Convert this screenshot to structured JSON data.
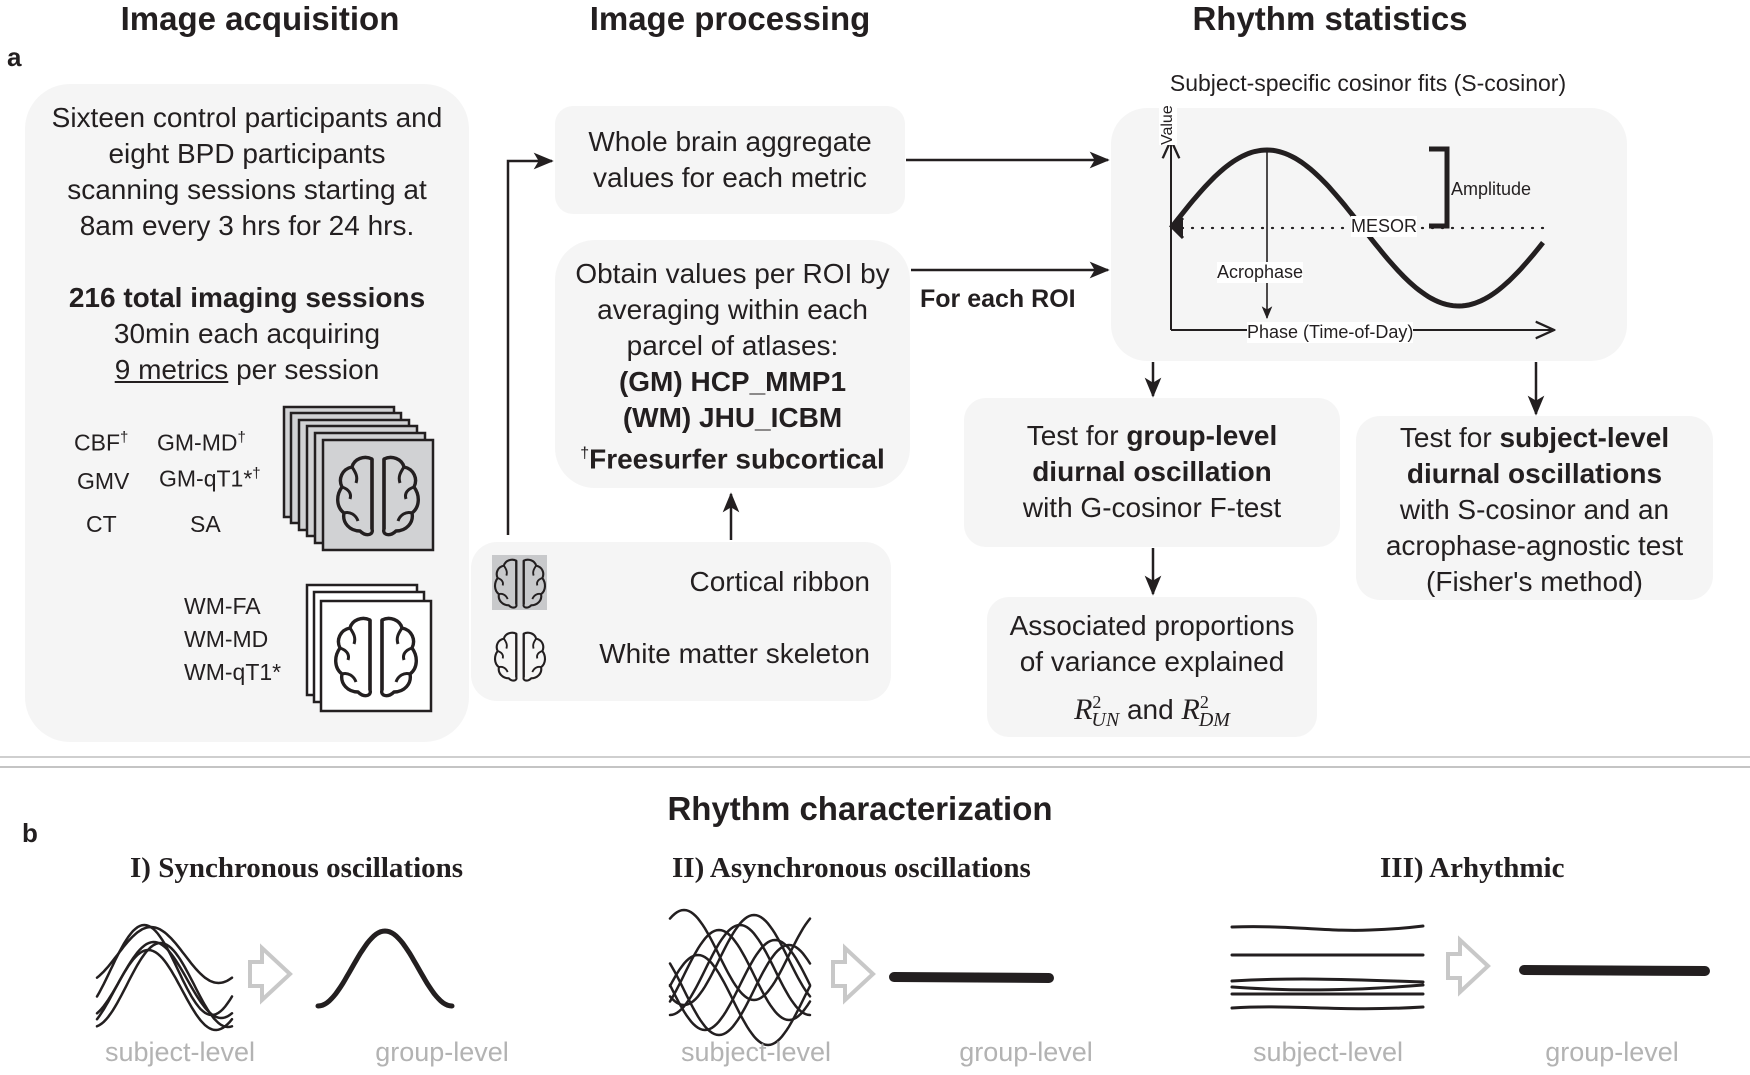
{
  "panel_labels": {
    "a": "a",
    "b": "b"
  },
  "headers": {
    "acquisition": "Image acquisition",
    "processing": "Image processing",
    "statistics": "Rhythm statistics",
    "characterization": "Rhythm characterization"
  },
  "acquisition": {
    "description_lines": [
      "Sixteen control participants and",
      "eight BPD participants",
      "scanning sessions starting at",
      "8am every 3 hrs for 24 hrs."
    ],
    "sessions_bold": "216 total imaging sessions",
    "duration": "30min each acquiring",
    "metrics_underlined": "9 metrics",
    "metrics_suffix": " per session",
    "gm_metrics": [
      {
        "label": "CBF",
        "mark": "†"
      },
      {
        "label": "GM-MD",
        "mark": "†"
      },
      {
        "label": "GMV",
        "mark": ""
      },
      {
        "label": "GM-qT1*",
        "mark": "†"
      },
      {
        "label": "CT",
        "mark": ""
      },
      {
        "label": "SA",
        "mark": ""
      }
    ],
    "wm_metrics": [
      "WM-FA",
      "WM-MD",
      "WM-qT1*"
    ]
  },
  "processing": {
    "whole_brain": [
      "Whole brain aggregate",
      "values for each metric"
    ],
    "roi_lines": [
      "Obtain values per ROI by",
      "averaging within each",
      "parcel of atlases:"
    ],
    "atlases": [
      "(GM) HCP_MMP1",
      "(WM) JHU_ICBM"
    ],
    "subcortical_mark": "†",
    "subcortical": "Freesurfer subcortical",
    "for_each_roi": "For each ROI",
    "masks": [
      {
        "icon": "brain-gray-icon",
        "label": "Cortical ribbon"
      },
      {
        "icon": "brain-outline-icon",
        "label": "White matter skeleton"
      }
    ]
  },
  "statistics": {
    "cosinor_title": "Subject-specific cosinor fits (S-cosinor)",
    "cosinor_labels": {
      "value": "Value",
      "amplitude": "Amplitude",
      "mesor": "MESOR",
      "acrophase": "Acrophase",
      "phase": "Phase (Time-of-Day)"
    },
    "group_test": {
      "pre": "Test for ",
      "bold1": "group-level",
      "bold2": "diurnal oscillation",
      "post": "with G-cosinor F-test"
    },
    "subject_test": {
      "pre": "Test for ",
      "bold1": "subject-level",
      "bold2": "diurnal oscillations",
      "post1": "with S-cosinor and an",
      "post2": "acrophase-agnostic test",
      "post3": "(Fisher's method)"
    },
    "variance": {
      "line1": "Associated proportions",
      "line2": "of variance explained",
      "r": "R",
      "sup": "2",
      "sub1": "UN",
      "and": " and ",
      "sub2": "DM"
    }
  },
  "characterization": {
    "cases": [
      {
        "title": "I) Synchronous oscillations",
        "subject": "subject-level",
        "group": "group-level"
      },
      {
        "title": "II) Asynchronous oscillations",
        "subject": "subject-level",
        "group": "group-level"
      },
      {
        "title": "III) Arhythmic",
        "subject": "subject-level",
        "group": "group-level"
      }
    ]
  },
  "colors": {
    "box": "#f5f5f5",
    "ink": "#231f20",
    "muted": "#b3b3b3",
    "brain_fill": "#cccccc",
    "divider": "#c8c8c8"
  }
}
